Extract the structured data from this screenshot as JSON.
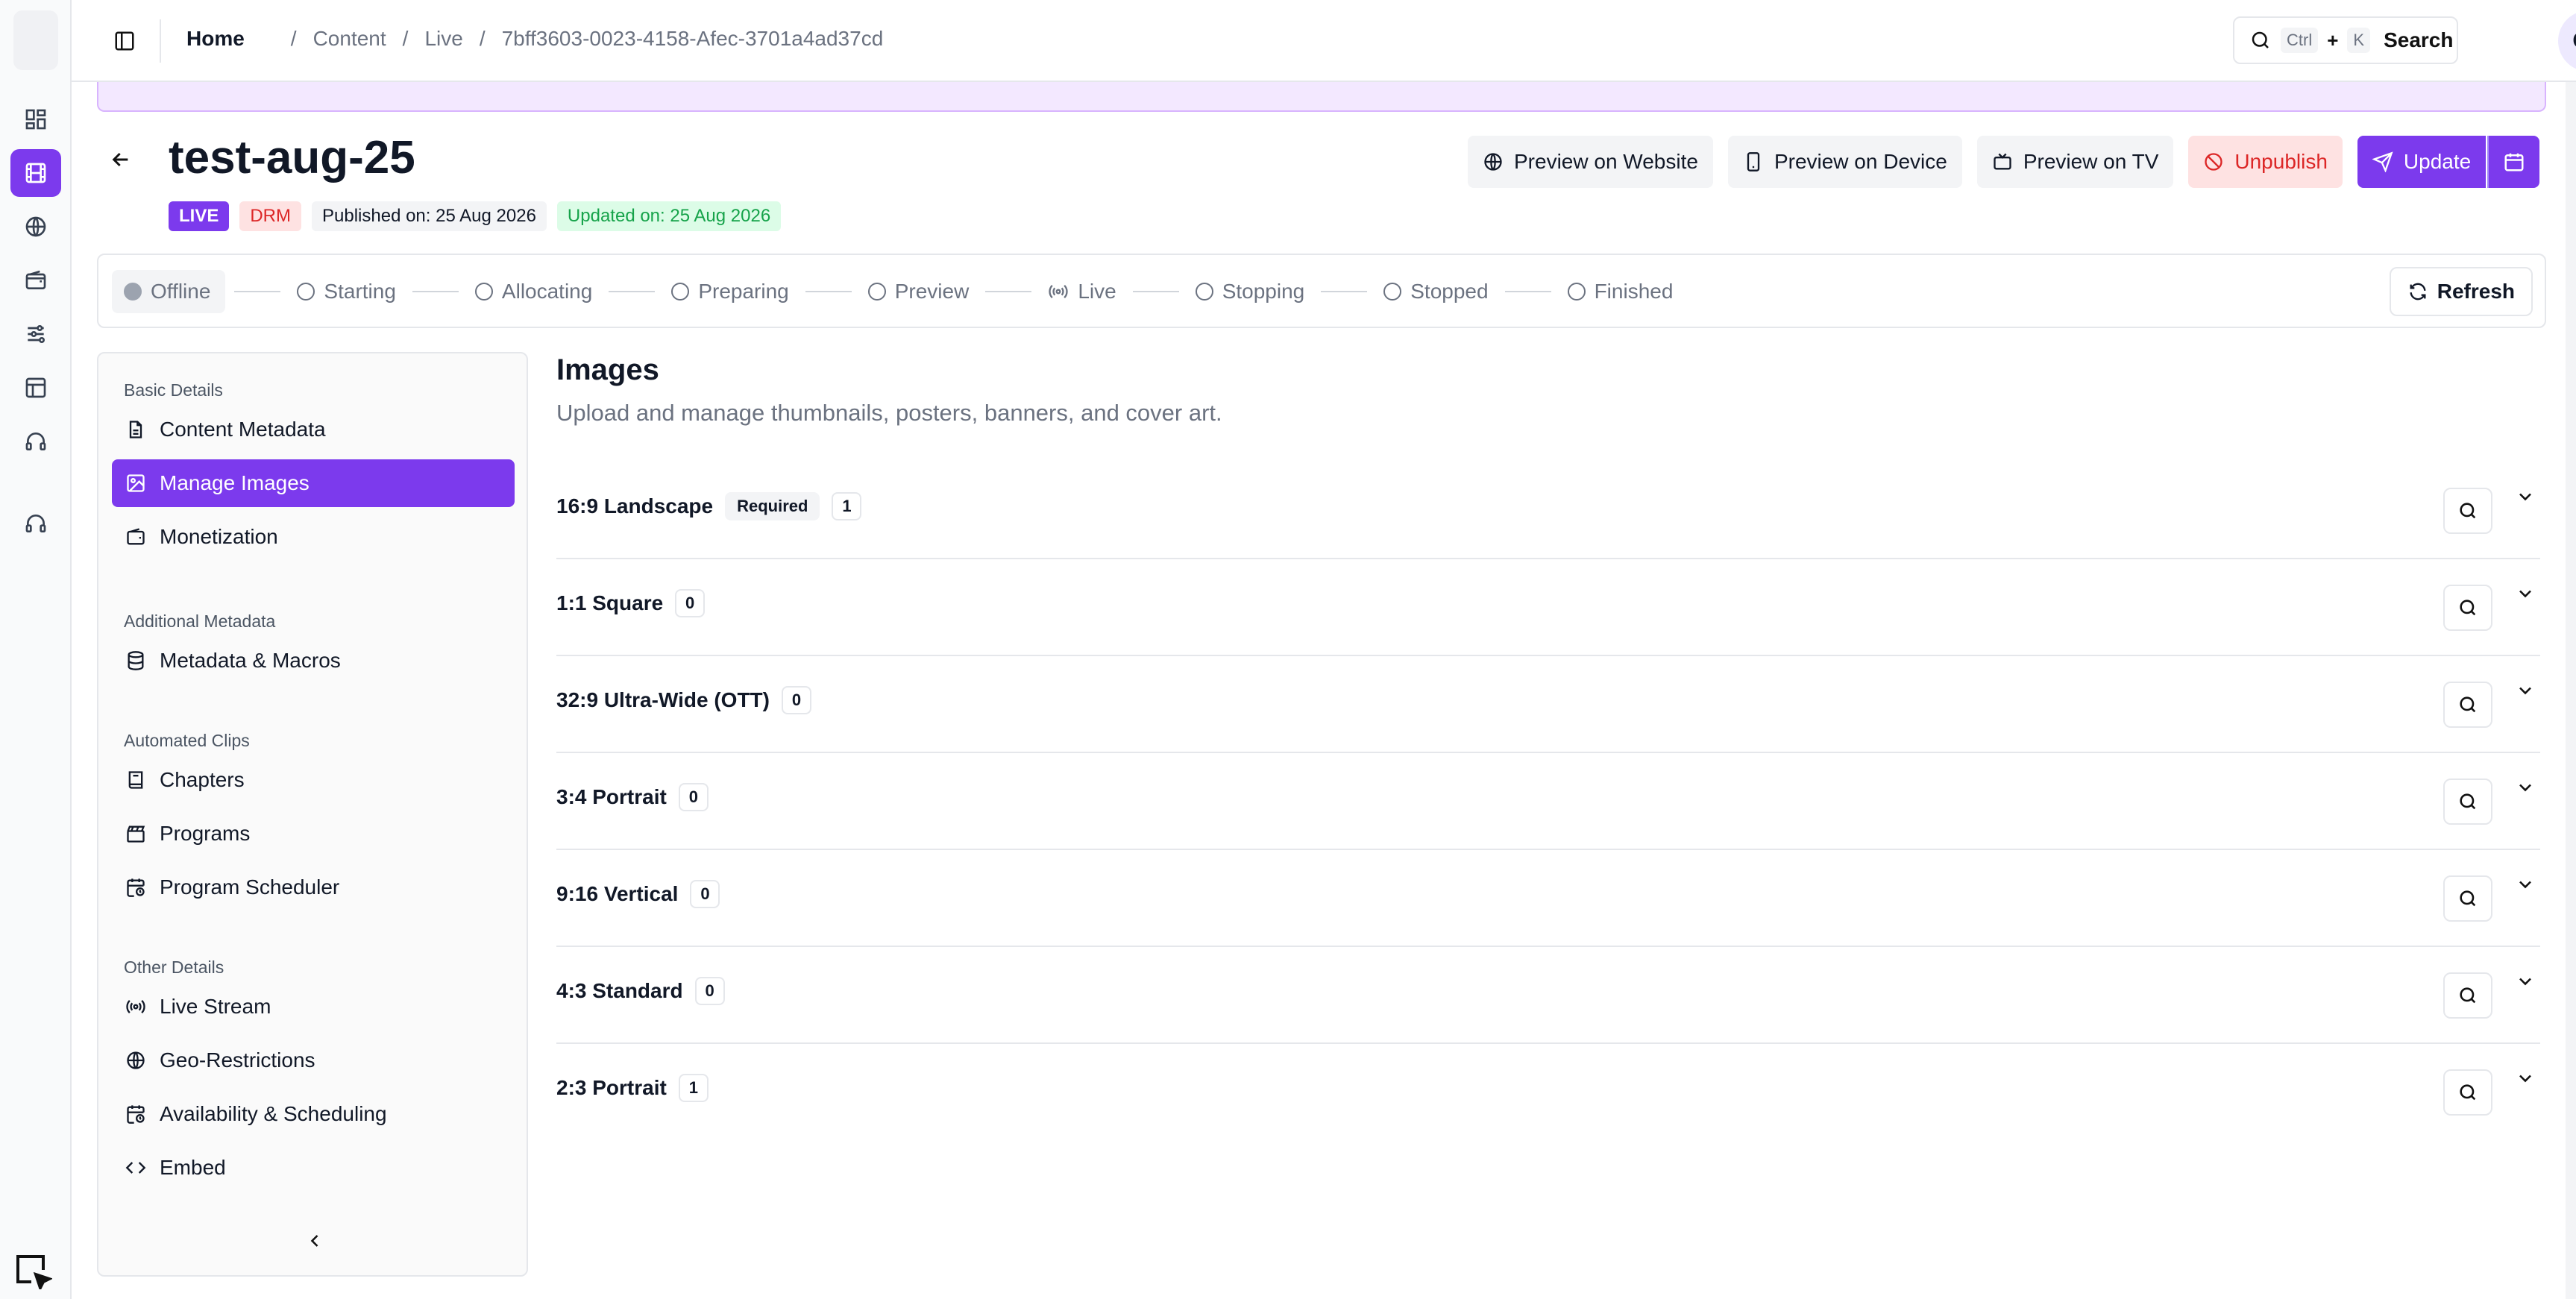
{
  "topbar": {
    "breadcrumb": [
      "Home",
      "Content",
      "Live",
      "7bff3603-0023-4158-Afec-3701a4ad37cd"
    ],
    "search": {
      "key1": "Ctrl",
      "plus": "+",
      "key2": "K",
      "label": "Search"
    },
    "avatar_initials": "GS"
  },
  "header": {
    "title": "test-aug-25",
    "badges": {
      "live": "LIVE",
      "drm": "DRM",
      "published": "Published on: 25 Aug 2026",
      "updated": "Updated on: 25 Aug 2026"
    },
    "actions": {
      "preview_website": "Preview on Website",
      "preview_device": "Preview on Device",
      "preview_tv": "Preview on TV",
      "unpublish": "Unpublish",
      "update": "Update"
    }
  },
  "stepper": {
    "steps": [
      "Offline",
      "Starting",
      "Allocating",
      "Preparing",
      "Preview",
      "Live",
      "Stopping",
      "Stopped",
      "Finished"
    ],
    "current": "Offline",
    "refresh_label": "Refresh"
  },
  "nav": {
    "sections": [
      {
        "title": "Basic Details",
        "items": [
          "Content Metadata",
          "Manage Images",
          "Monetization"
        ]
      },
      {
        "title": "Additional Metadata",
        "items": [
          "Metadata & Macros"
        ]
      },
      {
        "title": "Automated Clips",
        "items": [
          "Chapters",
          "Programs",
          "Program Scheduler"
        ]
      },
      {
        "title": "Other Details",
        "items": [
          "Live Stream",
          "Geo-Restrictions",
          "Availability & Scheduling",
          "Embed"
        ]
      }
    ],
    "active": "Manage Images"
  },
  "main": {
    "title": "Images",
    "subtitle": "Upload and manage thumbnails, posters, banners, and cover art.",
    "rows": [
      {
        "label": "16:9 Landscape",
        "tag": "Required",
        "count": "1"
      },
      {
        "label": "1:1 Square",
        "tag": "",
        "count": "0"
      },
      {
        "label": "32:9 Ultra-Wide (OTT)",
        "tag": "",
        "count": "0"
      },
      {
        "label": "3:4 Portrait",
        "tag": "",
        "count": "0"
      },
      {
        "label": "9:16 Vertical",
        "tag": "",
        "count": "0"
      },
      {
        "label": "4:3 Standard",
        "tag": "",
        "count": "0"
      },
      {
        "label": "2:3 Portrait",
        "tag": "",
        "count": "1"
      }
    ]
  },
  "colors": {
    "accent": "#7c3aed",
    "danger": "#dc2626",
    "success": "#16a34a"
  }
}
